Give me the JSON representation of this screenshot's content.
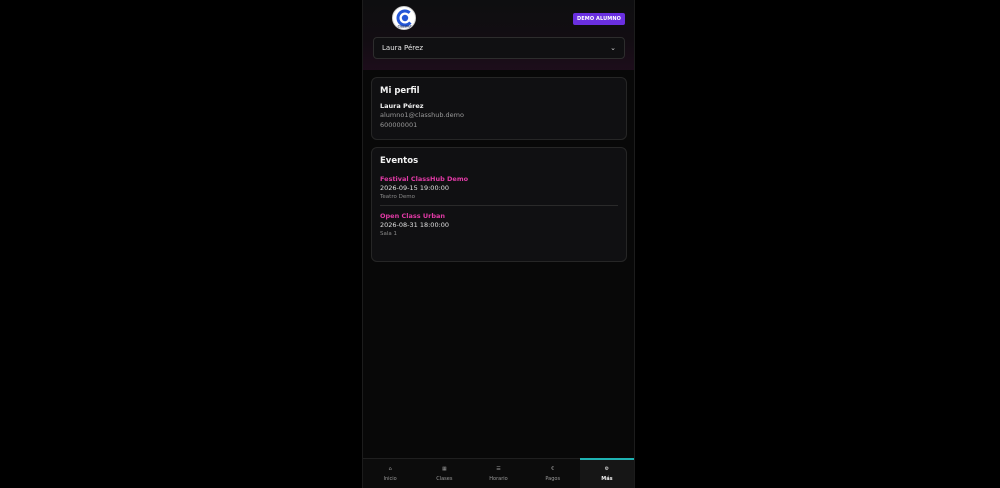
{
  "header": {
    "logo_text": "ClassHub",
    "demo_badge": "DEMO ALUMNO",
    "student_select": {
      "value": "Laura Pérez"
    }
  },
  "profile": {
    "title": "Mi perfil",
    "name": "Laura Pérez",
    "email": "alumno1@classhub.demo",
    "phone": "600000001"
  },
  "events": {
    "title": "Eventos",
    "items": [
      {
        "title": "Festival ClassHub Demo",
        "datetime": "2026-09-15 19:00:00",
        "venue": "Teatro Demo"
      },
      {
        "title": "Open Class Urban",
        "datetime": "2026-08-31 18:00:00",
        "venue": "Sala 1"
      }
    ]
  },
  "nav": {
    "items": [
      {
        "label": "Inicio",
        "icon": "⌂"
      },
      {
        "label": "Clases",
        "icon": "▦"
      },
      {
        "label": "Horario",
        "icon": "☰"
      },
      {
        "label": "Pagos",
        "icon": "€"
      },
      {
        "label": "Más",
        "icon": "⚙"
      }
    ],
    "active": "Más"
  },
  "colors": {
    "accent_pink": "#e23aa6",
    "badge_purple": "#6a2fe0",
    "nav_active_teal": "#1fb3b3"
  }
}
